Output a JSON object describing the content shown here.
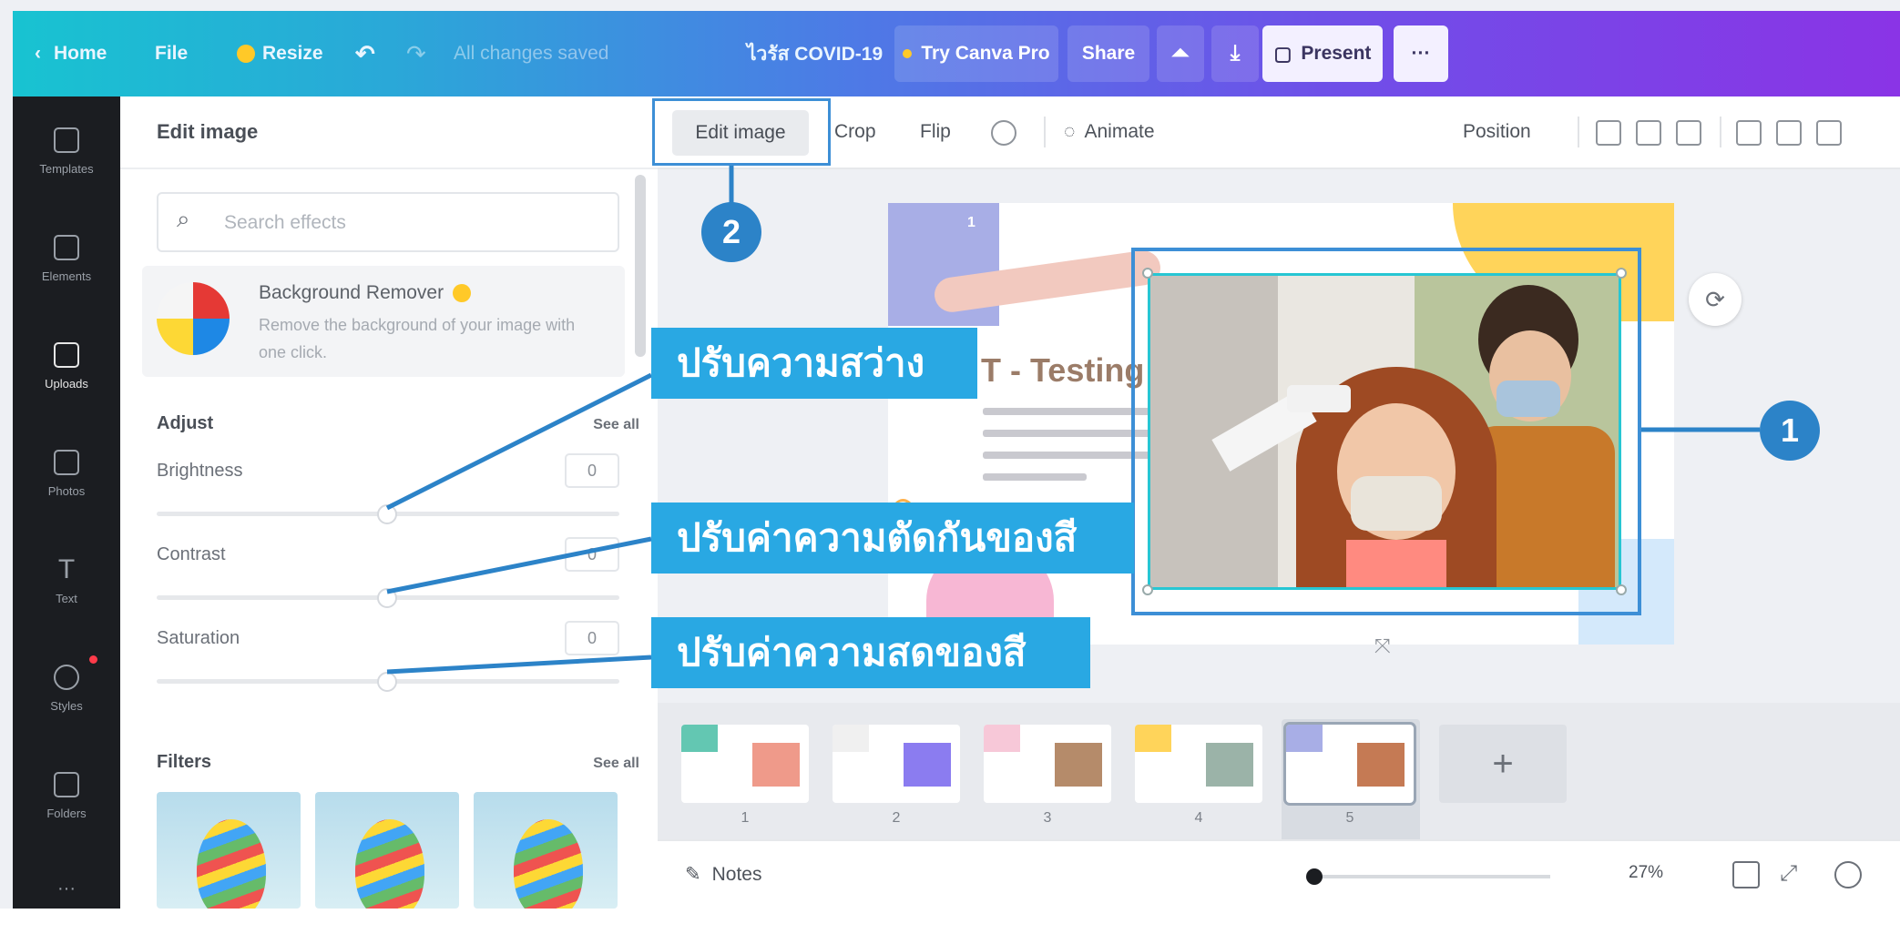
{
  "topbar": {
    "home": "Home",
    "file": "File",
    "resize": "Resize",
    "save_status": "All changes saved",
    "doc_title": "ไวรัส COVID-19",
    "try_pro": "Try Canva Pro",
    "share": "Share",
    "present": "Present",
    "more": "···"
  },
  "rail": {
    "items": [
      {
        "label": "Templates",
        "icon": "templates-icon"
      },
      {
        "label": "Elements",
        "icon": "elements-icon"
      },
      {
        "label": "Uploads",
        "icon": "uploads-icon"
      },
      {
        "label": "Photos",
        "icon": "photos-icon"
      },
      {
        "label": "Text",
        "icon": "text-icon"
      },
      {
        "label": "Styles",
        "icon": "styles-icon"
      },
      {
        "label": "Folders",
        "icon": "folders-icon"
      }
    ],
    "more": "···"
  },
  "panel": {
    "title": "Edit image",
    "search_placeholder": "Search effects",
    "bg_remover": {
      "title": "Background Remover",
      "desc": "Remove the background of your image with one click."
    },
    "adjust": {
      "title": "Adjust",
      "see_all": "See all",
      "brightness": {
        "label": "Brightness",
        "value": "0"
      },
      "contrast": {
        "label": "Contrast",
        "value": "0"
      },
      "saturation": {
        "label": "Saturation",
        "value": "0"
      }
    },
    "filters": {
      "title": "Filters",
      "see_all": "See all"
    }
  },
  "subbar": {
    "edit_image": "Edit image",
    "crop": "Crop",
    "flip": "Flip",
    "animate": "Animate",
    "position": "Position"
  },
  "slide": {
    "title": "T - Testing",
    "number": "1"
  },
  "callouts": {
    "brightness": "ปรับความสว่าง",
    "contrast": "ปรับค่าความตัดกันของสี",
    "saturation": "ปรับค่าความสดของสี",
    "badge1": "1",
    "badge2": "2"
  },
  "pages": {
    "numbers": [
      "1",
      "2",
      "3",
      "4",
      "5"
    ],
    "add": "+"
  },
  "bottombar": {
    "notes": "Notes",
    "zoom": "27%"
  },
  "colors": {
    "accent": "#29a8e3",
    "badge": "#2c83c8",
    "highlight": "#3d8fd6"
  }
}
